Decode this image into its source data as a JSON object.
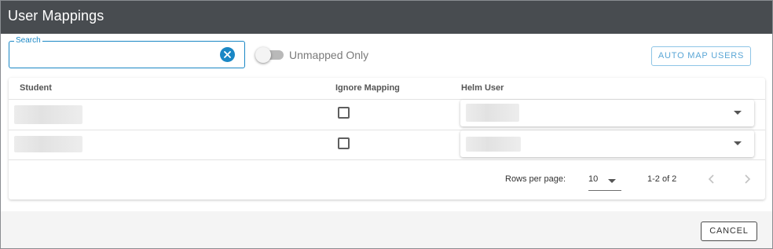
{
  "dialog": {
    "title": "User Mappings"
  },
  "search": {
    "label": "Search",
    "value": "",
    "clear_icon": "close-circle-icon"
  },
  "filter": {
    "toggle_label": "Unmapped Only",
    "enabled": false
  },
  "actions": {
    "auto_map_label": "AUTO MAP USERS",
    "cancel_label": "CANCEL"
  },
  "table": {
    "headers": {
      "student": "Student",
      "ignore": "Ignore Mapping",
      "helm_user": "Helm User"
    },
    "rows": [
      {
        "ignore_mapping": false
      },
      {
        "ignore_mapping": false
      }
    ]
  },
  "pagination": {
    "rows_per_page_label": "Rows per page:",
    "rows_per_page_value": "10",
    "range_text": "1-2 of 2"
  },
  "colors": {
    "titlebar": "#484c50",
    "accent": "#1a87c5",
    "footer": "#f4f4f4"
  }
}
